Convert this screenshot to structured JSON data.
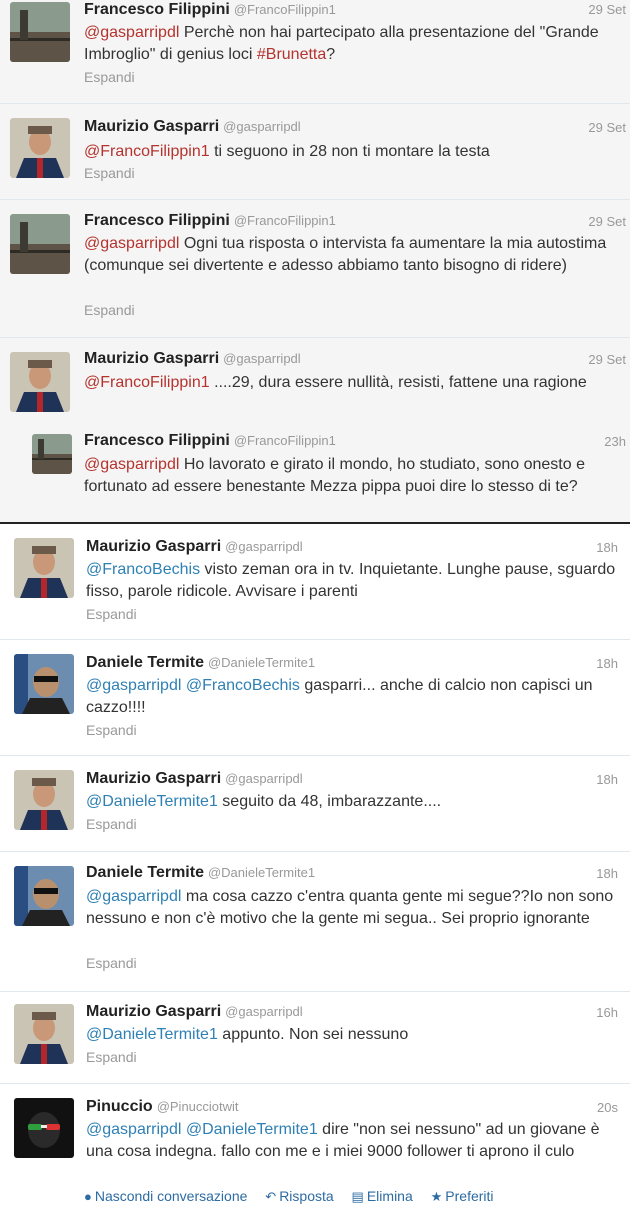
{
  "tweets": [
    {
      "name": "Francesco Filippini",
      "handle": "@FrancoFilippin1",
      "time": "29 Set",
      "parts": [
        {
          "t": "@gasparripdl",
          "k": "m"
        },
        {
          "t": " Perchè non hai partecipato alla presentazione del \"Grande Imbroglio\" di genius loci ",
          "k": ""
        },
        {
          "t": "#Brunetta",
          "k": "h"
        },
        {
          "t": "?",
          "k": ""
        }
      ],
      "expand": "Espandi"
    },
    {
      "name": "Maurizio Gasparri",
      "handle": "@gasparripdl",
      "time": "29 Set",
      "parts": [
        {
          "t": "@FrancoFilippin1",
          "k": "m"
        },
        {
          "t": " ti seguono in 28 non ti montare la testa",
          "k": ""
        }
      ],
      "expand": "Espandi"
    },
    {
      "name": "Francesco Filippini",
      "handle": "@FrancoFilippin1",
      "time": "29 Set",
      "parts": [
        {
          "t": "@gasparripdl",
          "k": "m"
        },
        {
          "t": " Ogni tua risposta o intervista fa aumentare la mia autostima (comunque sei divertente e adesso abbiamo tanto bisogno di ridere)",
          "k": ""
        }
      ],
      "expand": "Espandi"
    },
    {
      "name": "Maurizio Gasparri",
      "handle": "@gasparripdl",
      "time": "29 Set",
      "parts": [
        {
          "t": "@FrancoFilippin1",
          "k": "m"
        },
        {
          "t": " ....29, dura essere nullità, resisti, fattene una ragione",
          "k": ""
        }
      ],
      "expand": ""
    },
    {
      "name": "Francesco Filippini",
      "handle": "@FrancoFilippin1",
      "time": "23h",
      "parts": [
        {
          "t": "@gasparripdl",
          "k": "m"
        },
        {
          "t": " Ho lavorato e girato il mondo, ho studiato, sono onesto e fortunato ad essere benestante Mezza pippa puoi dire lo stesso di te?",
          "k": ""
        }
      ],
      "expand": ""
    },
    {
      "name": "Maurizio Gasparri",
      "handle": "@gasparripdl",
      "time": "18h",
      "parts": [
        {
          "t": "@FrancoBechis",
          "k": "b"
        },
        {
          "t": " visto zeman ora in tv. Inquietante. Lunghe pause, sguardo fisso, parole ridicole. Avvisare i parenti",
          "k": ""
        }
      ],
      "expand": "Espandi"
    },
    {
      "name": "Daniele Termite",
      "handle": "@DanieleTermite1",
      "time": "18h",
      "parts": [
        {
          "t": "@gasparripdl",
          "k": "b"
        },
        {
          "t": " ",
          "k": ""
        },
        {
          "t": "@FrancoBechis",
          "k": "b"
        },
        {
          "t": " gasparri... anche di calcio non capisci un cazzo!!!!",
          "k": ""
        }
      ],
      "expand": "Espandi"
    },
    {
      "name": "Maurizio Gasparri",
      "handle": "@gasparripdl",
      "time": "18h",
      "parts": [
        {
          "t": "@DanieleTermite1",
          "k": "b"
        },
        {
          "t": " seguito da 48, imbarazzante....",
          "k": ""
        }
      ],
      "expand": "Espandi"
    },
    {
      "name": "Daniele Termite",
      "handle": "@DanieleTermite1",
      "time": "18h",
      "parts": [
        {
          "t": "@gasparripdl",
          "k": "b"
        },
        {
          "t": " ma cosa cazzo c'entra quanta gente mi segue??Io non sono nessuno e non c'è motivo che la gente mi segua.. Sei proprio ignorante",
          "k": ""
        }
      ],
      "expand": "Espandi"
    },
    {
      "name": "Maurizio Gasparri",
      "handle": "@gasparripdl",
      "time": "16h",
      "parts": [
        {
          "t": "@DanieleTermite1",
          "k": "b"
        },
        {
          "t": " appunto. Non sei nessuno",
          "k": ""
        }
      ],
      "expand": "Espandi"
    },
    {
      "name": "Pinuccio",
      "handle": "@Pinucciotwit",
      "time": "20s",
      "parts": [
        {
          "t": "@gasparripdl",
          "k": "b"
        },
        {
          "t": " ",
          "k": ""
        },
        {
          "t": "@DanieleTermite1",
          "k": "b"
        },
        {
          "t": " dire \"non sei nessuno\" ad un giovane è una cosa indegna. fallo con me e i miei 9000 follower ti aprono il culo",
          "k": ""
        }
      ],
      "expand": ""
    }
  ],
  "actions": {
    "hide": "Nascondi conversazione",
    "reply": "Risposta",
    "delete": "Elimina",
    "favorite": "Preferiti"
  },
  "colors": {
    "mention_top": "#b5332e",
    "mention_bottom": "#2f80b5",
    "action": "#2c6ba3"
  }
}
